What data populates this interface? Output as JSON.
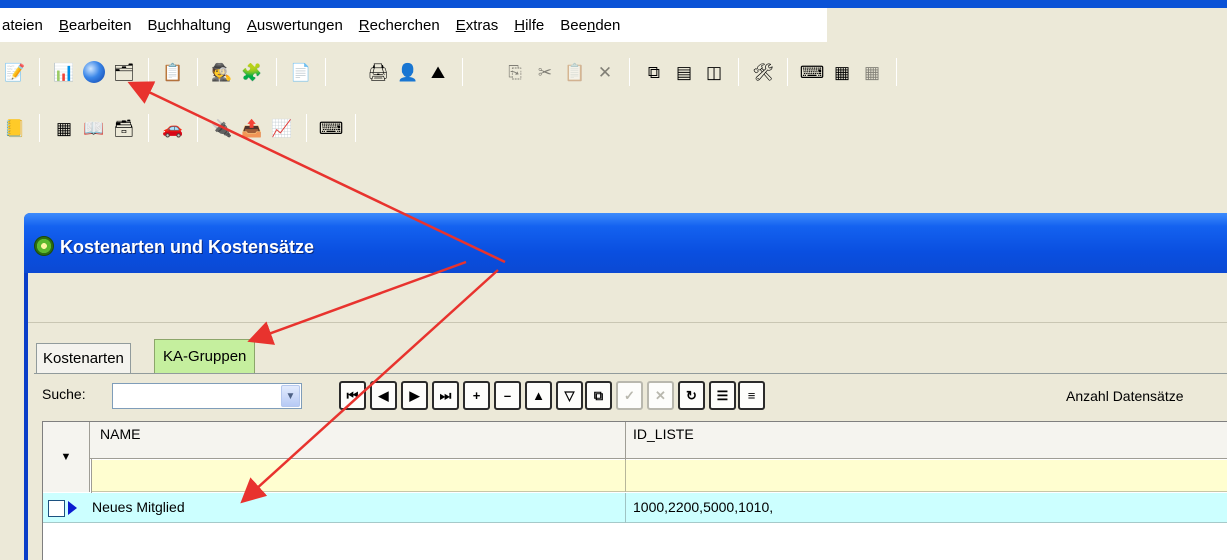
{
  "menubar": {
    "items": [
      {
        "label": "ateien",
        "underline_index": -1
      },
      {
        "label": "Bearbeiten",
        "underline_index": 0
      },
      {
        "label": "Buchhaltung",
        "underline_index": 1
      },
      {
        "label": "Auswertungen",
        "underline_index": 0
      },
      {
        "label": "Recherchen",
        "underline_index": 0
      },
      {
        "label": "Extras",
        "underline_index": 0
      },
      {
        "label": "Hilfe",
        "underline_index": 0
      },
      {
        "label": "Beenden",
        "underline_index": 3
      }
    ]
  },
  "toolbar1": {
    "icons": [
      "edit-form-icon",
      "chart-icon",
      "globe-icon",
      "properties-icon",
      "list-config-icon",
      "person-icon",
      "puzzle-icon",
      "document-icon",
      "printer-icon",
      "user-edit-icon",
      "landscape-icon",
      "copy-icon",
      "cut-icon",
      "paste-icon",
      "delete-icon",
      "cascade-windows-icon",
      "tile-horizontal-icon",
      "tile-vertical-icon",
      "tools-icon",
      "keyboard-icon",
      "xml-icon",
      "table-icon"
    ]
  },
  "toolbar2": {
    "icons": [
      "contacts-icon",
      "table-grid-icon",
      "book-icon",
      "tree-icon",
      "car-icon",
      "plug-icon",
      "export-icon",
      "report-icon",
      "terminal-icon"
    ]
  },
  "window": {
    "title": "Kostenarten und Kostensätze"
  },
  "tabs": {
    "kostenarten": "Kostenarten",
    "kagruppen": "KA-Gruppen",
    "active": "KA-Gruppen"
  },
  "search": {
    "label": "Suche:",
    "value": ""
  },
  "navigation": {
    "count_label": "Anzahl Datensätze"
  },
  "grid": {
    "columns": [
      "NAME",
      "ID_LISTE"
    ],
    "rows": [
      {
        "name": "Neues Mitglied",
        "id_liste": "1000,2200,5000,1010,"
      }
    ]
  },
  "colors": {
    "title_bar": "#0a4fe0",
    "active_tab": "#c5ef9e",
    "selected_row": "#ccffff",
    "filter_row": "#fffed0",
    "annotation_arrow": "#e8332e"
  }
}
